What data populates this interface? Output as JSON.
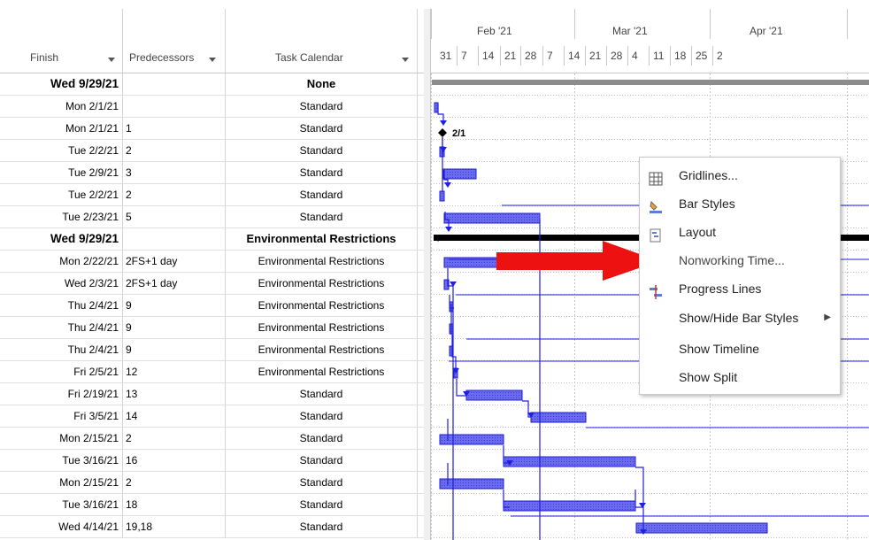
{
  "columns": {
    "finish": "Finish",
    "predecessors": "Predecessors",
    "calendar": "Task Calendar"
  },
  "rows": [
    {
      "finish": "Wed 9/29/21",
      "pred": "",
      "cal": "None",
      "summary": true
    },
    {
      "finish": "Mon 2/1/21",
      "pred": "",
      "cal": "Standard"
    },
    {
      "finish": "Mon 2/1/21",
      "pred": "1",
      "cal": "Standard"
    },
    {
      "finish": "Tue 2/2/21",
      "pred": "2",
      "cal": "Standard"
    },
    {
      "finish": "Tue 2/9/21",
      "pred": "3",
      "cal": "Standard"
    },
    {
      "finish": "Tue 2/2/21",
      "pred": "2",
      "cal": "Standard"
    },
    {
      "finish": "Tue 2/23/21",
      "pred": "5",
      "cal": "Standard"
    },
    {
      "finish": "Wed 9/29/21",
      "pred": "",
      "cal": "Environmental Restrictions",
      "summary": true
    },
    {
      "finish": "Mon 2/22/21",
      "pred": "2FS+1 day",
      "cal": "Environmental Restrictions"
    },
    {
      "finish": "Wed 2/3/21",
      "pred": "2FS+1 day",
      "cal": "Environmental Restrictions"
    },
    {
      "finish": "Thu 2/4/21",
      "pred": "9",
      "cal": "Environmental Restrictions"
    },
    {
      "finish": "Thu 2/4/21",
      "pred": "9",
      "cal": "Environmental Restrictions"
    },
    {
      "finish": "Thu 2/4/21",
      "pred": "9",
      "cal": "Environmental Restrictions"
    },
    {
      "finish": "Fri 2/5/21",
      "pred": "12",
      "cal": "Environmental Restrictions"
    },
    {
      "finish": "Fri 2/19/21",
      "pred": "13",
      "cal": "Standard"
    },
    {
      "finish": "Fri 3/5/21",
      "pred": "14",
      "cal": "Standard"
    },
    {
      "finish": "Mon 2/15/21",
      "pred": "2",
      "cal": "Standard"
    },
    {
      "finish": "Tue 3/16/21",
      "pred": "16",
      "cal": "Standard"
    },
    {
      "finish": "Mon 2/15/21",
      "pred": "2",
      "cal": "Standard"
    },
    {
      "finish": "Tue 3/16/21",
      "pred": "18",
      "cal": "Standard"
    },
    {
      "finish": "Wed 4/14/21",
      "pred": "19,18",
      "cal": "Standard"
    }
  ],
  "timescale": {
    "months": [
      "Feb '21",
      "Mar '21",
      "Apr '21"
    ],
    "days": [
      "31",
      "7",
      "14",
      "21",
      "28",
      "7",
      "14",
      "21",
      "28",
      "4",
      "11",
      "18",
      "25",
      "2"
    ]
  },
  "milestone_label": "2/1",
  "context_menu": [
    {
      "label": "Gridlines...",
      "icon": "gridlines-icon"
    },
    {
      "label": "Bar Styles",
      "icon": "bar-styles-icon"
    },
    {
      "label": "Layout",
      "icon": "layout-icon"
    },
    {
      "label": "Nonworking Time...",
      "icon": "",
      "highlighted": true
    },
    {
      "label": "Progress Lines",
      "icon": "progress-lines-icon"
    },
    {
      "label": "Show/Hide Bar Styles",
      "icon": "",
      "submenu": true
    },
    {
      "label": "Show Timeline",
      "icon": ""
    },
    {
      "label": "Show Split",
      "icon": ""
    }
  ],
  "colors": {
    "task_bar": "#6b6bef",
    "task_bar_border": "#1f1fcc",
    "link": "#1f1fe0",
    "summary_bar": "#000000",
    "project_summary": "#8c8c8c",
    "arrow": "#ee1111"
  }
}
